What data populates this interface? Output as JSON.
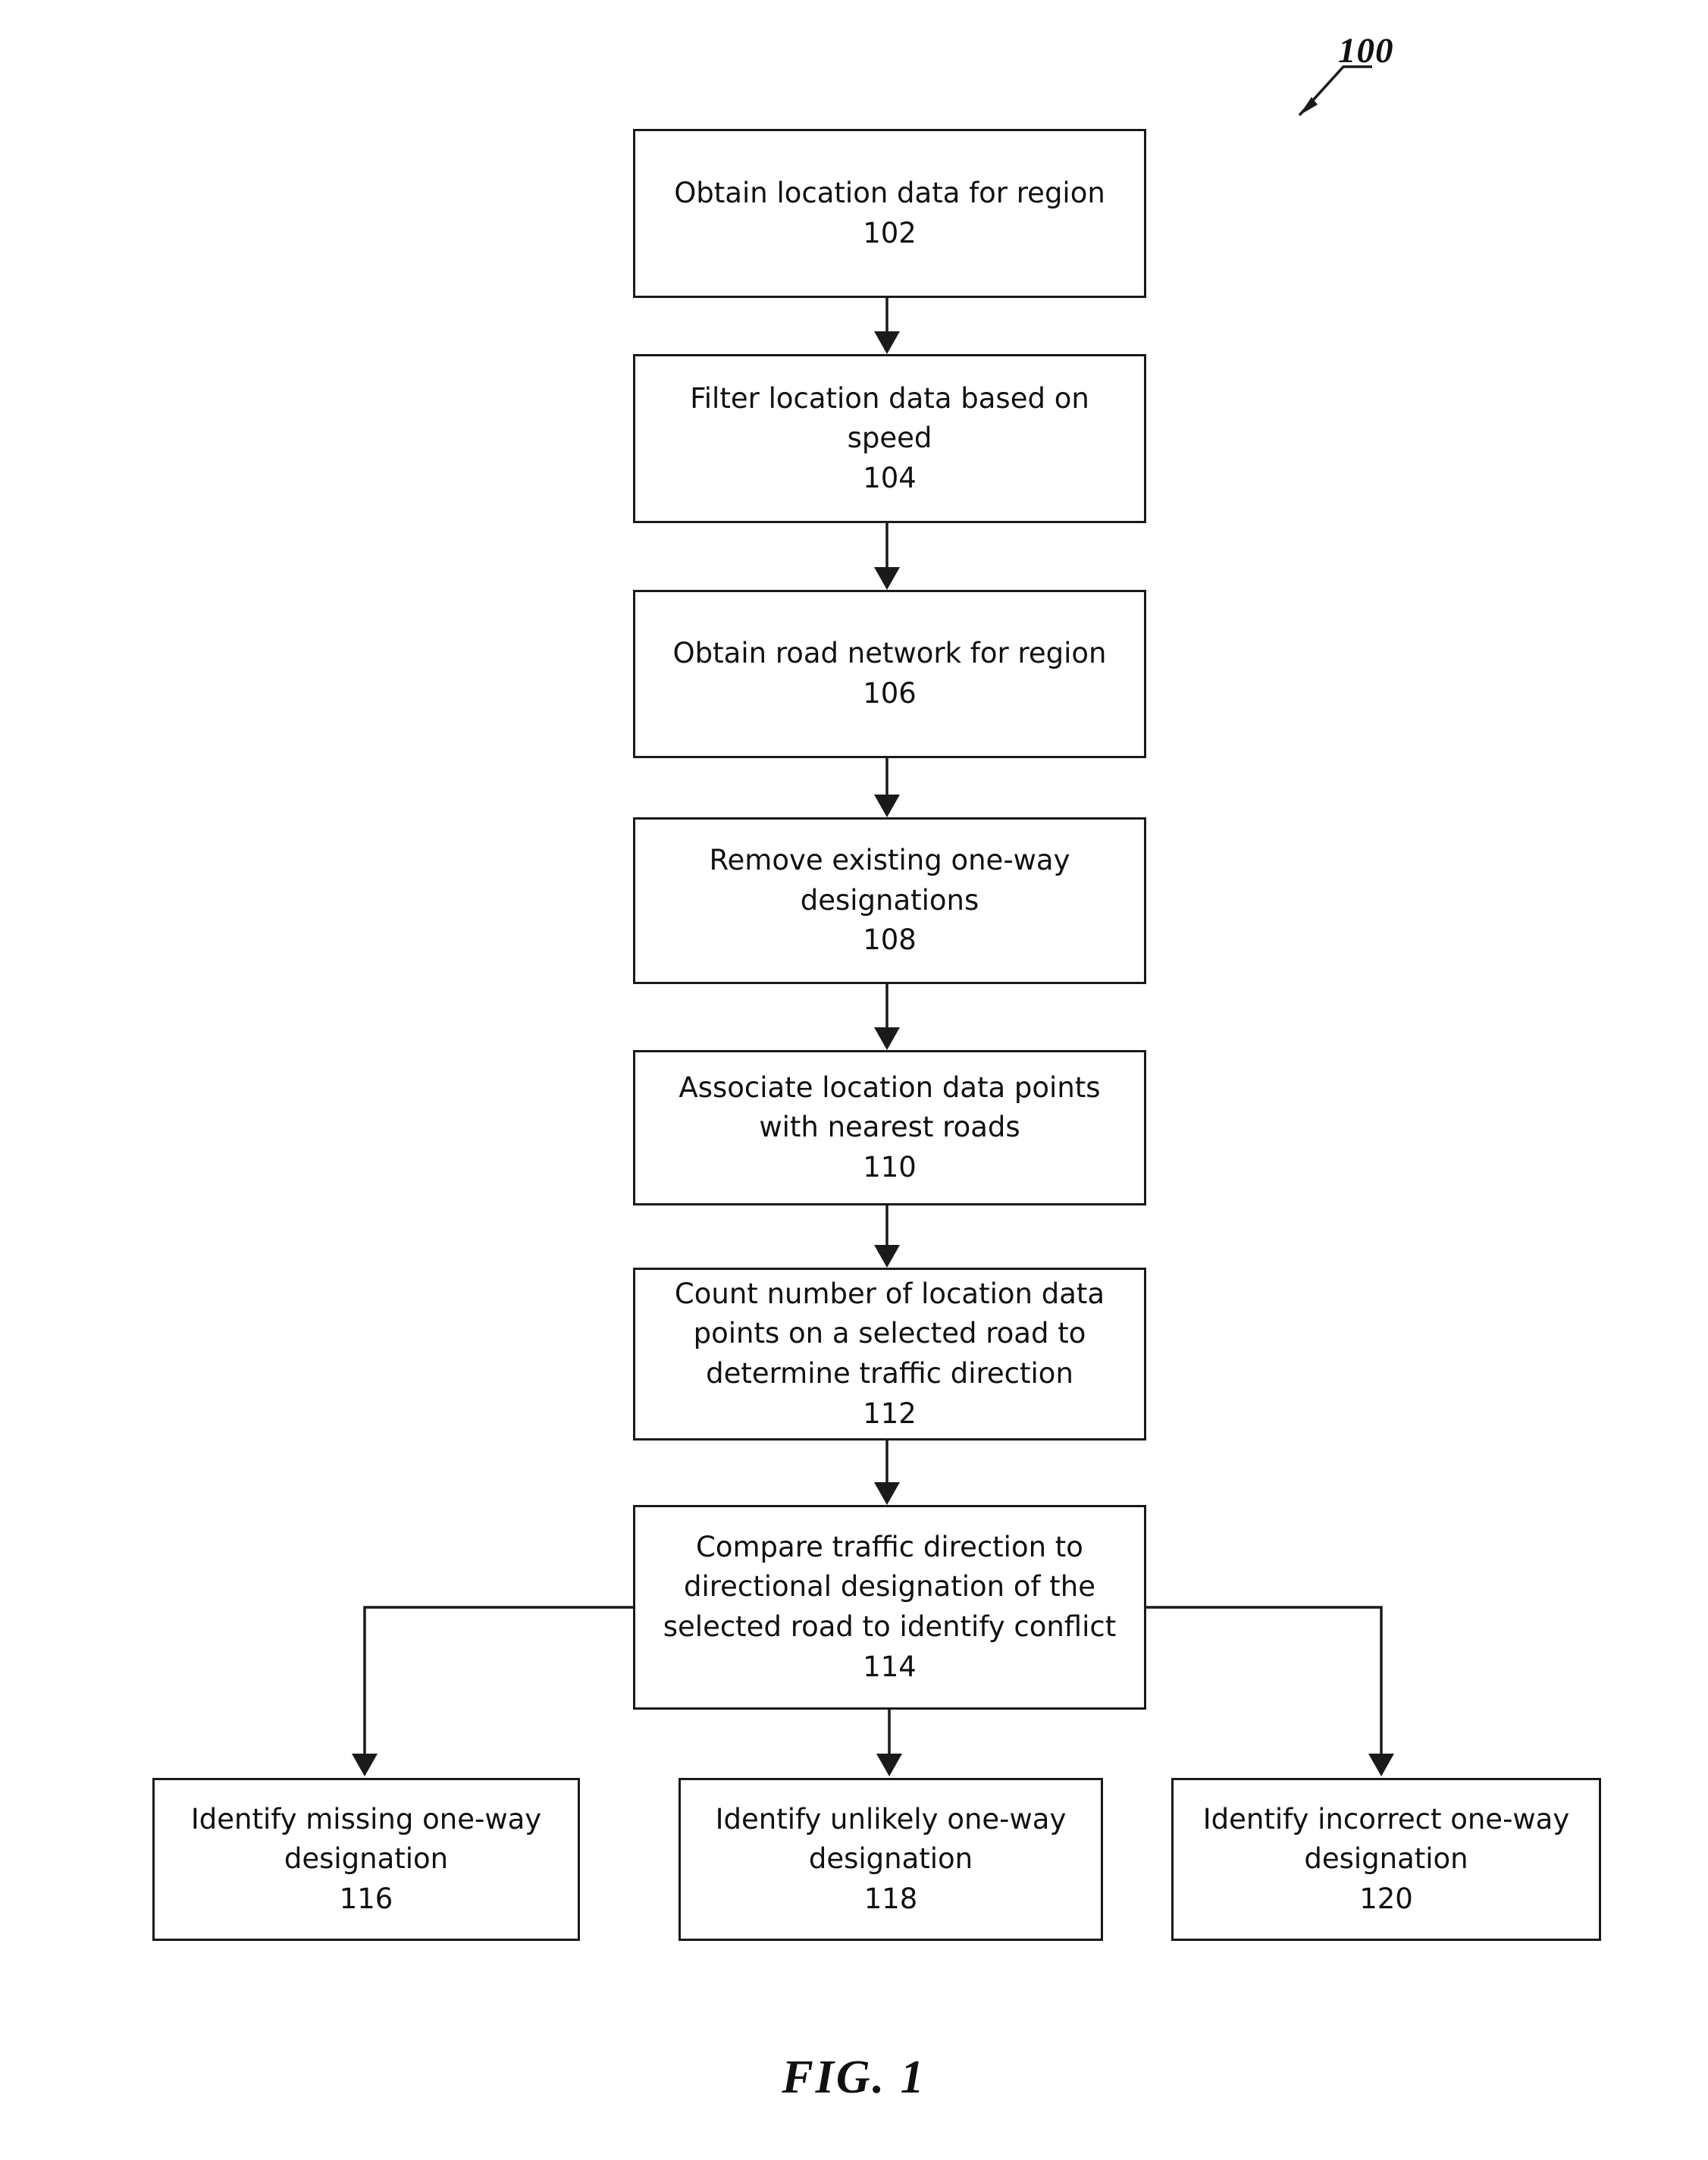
{
  "figure": {
    "caption": "FIG. 1",
    "reference_numeral": "100"
  },
  "flowchart": {
    "type": "patent-process-flow",
    "nodes": [
      {
        "id": "102",
        "label": "Obtain location data for region",
        "ref": "102"
      },
      {
        "id": "104",
        "label": "Filter location data based on\nspeed",
        "ref": "104"
      },
      {
        "id": "106",
        "label": "Obtain road network for region",
        "ref": "106"
      },
      {
        "id": "108",
        "label": "Remove existing one-way\ndesignations",
        "ref": "108"
      },
      {
        "id": "110",
        "label": "Associate location data points\nwith nearest roads",
        "ref": "110"
      },
      {
        "id": "112",
        "label": "Count number of location data\npoints on a selected road to\ndetermine traffic direction",
        "ref": "112"
      },
      {
        "id": "114",
        "label": "Compare traffic direction to\ndirectional designation of the\nselected road to identify conflict",
        "ref": "114"
      },
      {
        "id": "116",
        "label": "Identify missing one-way\ndesignation",
        "ref": "116"
      },
      {
        "id": "118",
        "label": "Identify unlikely one-way\ndesignation",
        "ref": "118"
      },
      {
        "id": "120",
        "label": "Identify incorrect one-way\ndesignation",
        "ref": "120"
      }
    ],
    "edges": [
      {
        "from": "102",
        "to": "104"
      },
      {
        "from": "104",
        "to": "106"
      },
      {
        "from": "106",
        "to": "108"
      },
      {
        "from": "108",
        "to": "110"
      },
      {
        "from": "110",
        "to": "112"
      },
      {
        "from": "112",
        "to": "114"
      },
      {
        "from": "114",
        "to": "116"
      },
      {
        "from": "114",
        "to": "118"
      },
      {
        "from": "114",
        "to": "120"
      }
    ]
  },
  "colors": {
    "stroke": "#1a1a1a",
    "text": "#111111",
    "background": "#ffffff"
  }
}
